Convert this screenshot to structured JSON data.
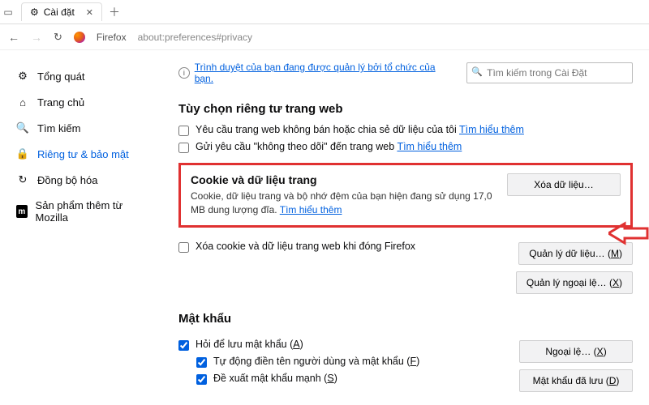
{
  "window": {
    "tab_title": "Cài đặt"
  },
  "urlbar": {
    "product": "Firefox",
    "path": "about:preferences#privacy"
  },
  "topnotice": {
    "text": "Trình duyệt của bạn đang được quản lý bởi tổ chức của bạn."
  },
  "search": {
    "placeholder": "Tìm kiếm trong Cài Đặt"
  },
  "sidebar": {
    "general": "Tổng quát",
    "home": "Trang chủ",
    "search": "Tìm kiếm",
    "privacy": "Riêng tư & bảo mật",
    "sync": "Đồng bộ hóa",
    "more": "Sản phẩm thêm từ Mozilla",
    "moz_badge": "m"
  },
  "sec_webpriv": {
    "title": "Tùy chọn riêng tư trang web",
    "opt1": "Yêu cầu trang web không bán hoặc chia sẻ dữ liệu của tôi",
    "opt2": "Gửi yêu cầu \"không theo dõi\" đến trang web",
    "learn": "Tìm hiểu thêm"
  },
  "sec_cookie": {
    "title": "Cookie và dữ liệu trang",
    "desc_a": "Cookie, dữ liệu trang và bộ nhớ đệm của bạn hiện đang sử dụng 17,0 MB dung lượng đĩa.",
    "learn": "Tìm hiểu thêm",
    "btn_clear": "Xóa dữ liệu…",
    "btn_manage": "Quản lý dữ liệu… (",
    "btn_manage_k": "M",
    "btn_except": "Quản lý ngoại lệ… (",
    "btn_except_k": "X",
    "close_paren": ")",
    "opt_delete_on_close": "Xóa cookie và dữ liệu trang web khi đóng Firefox"
  },
  "sec_pw": {
    "title": "Mật khẩu",
    "ask_save": "Hỏi để lưu mật khẩu (",
    "ask_save_k": "A",
    "autofill": "Tự động điền tên người dùng và mật khẩu (",
    "autofill_k": "F",
    "suggest": "Đề xuất mật khẩu mạnh (",
    "suggest_k": "S",
    "close_paren": ")",
    "btn_except": "Ngoại lệ… (",
    "btn_except_k": "X",
    "btn_saved": "Mật khẩu đã lưu (",
    "btn_saved_k": "D"
  }
}
